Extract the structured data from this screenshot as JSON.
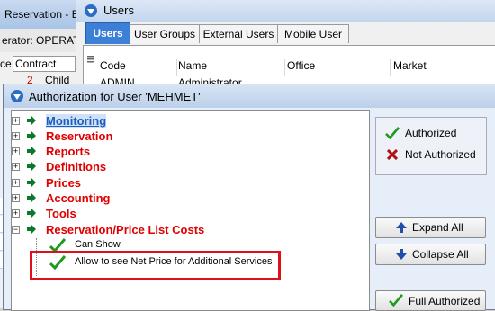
{
  "background_window": {
    "title": "Reservation - Ed",
    "operator_label": "erator: OPERATO",
    "contract_prefix": "ce",
    "contract_value": "Contract",
    "child_number": "2",
    "child_label": "Child"
  },
  "users_window": {
    "title": "Users",
    "tabs": [
      {
        "label": "Users",
        "active": true
      },
      {
        "label": "User Groups",
        "active": false
      },
      {
        "label": "External Users",
        "active": false
      },
      {
        "label": "Mobile User",
        "active": false
      }
    ],
    "columns": [
      "Code",
      "Name",
      "Office",
      "Market"
    ],
    "first_row": {
      "code": "ADMIN",
      "name": "Administrator"
    }
  },
  "dialog": {
    "title": "Authorization for User 'MEHMET'",
    "tree": [
      {
        "label": "Monitoring",
        "selected": true
      },
      {
        "label": "Reservation",
        "selected": false
      },
      {
        "label": "Reports",
        "selected": false
      },
      {
        "label": "Definitions",
        "selected": false
      },
      {
        "label": "Prices",
        "selected": false
      },
      {
        "label": "Accounting",
        "selected": false
      },
      {
        "label": "Tools",
        "selected": false
      },
      {
        "label": "Reservation/Price List Costs",
        "selected": false,
        "expanded": true
      }
    ],
    "leaves": [
      {
        "label": "Can Show",
        "authorized": true
      },
      {
        "label": "Allow to see Net Price for Additional Services",
        "authorized": true
      }
    ],
    "legend": {
      "authorized": "Authorized",
      "not_authorized": "Not Authorized"
    },
    "buttons": {
      "expand_all": "Expand All",
      "collapse_all": "Collapse All",
      "full_authorized": "Full Authorized"
    }
  },
  "colors": {
    "category_text": "#e00000",
    "selected_text": "#1a5fbf",
    "checkmark": "#1f9a1f",
    "cross": "#b01010",
    "highlight_box": "#e0101a",
    "tab_active": "#3b7fd6"
  }
}
